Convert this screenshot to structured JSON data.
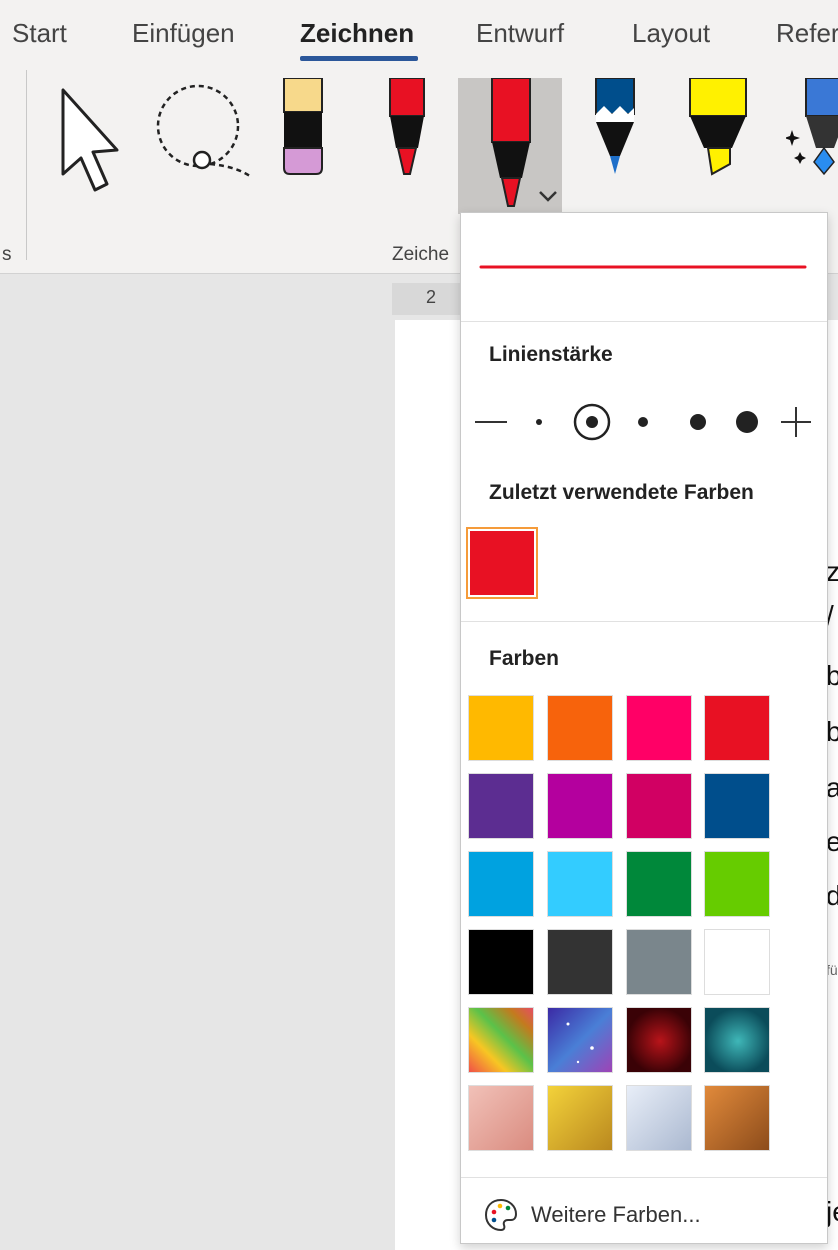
{
  "tabs": [
    {
      "label": "Start",
      "active": false
    },
    {
      "label": "Einfügen",
      "active": false
    },
    {
      "label": "Zeichnen",
      "active": true
    },
    {
      "label": "Entwurf",
      "active": false
    },
    {
      "label": "Layout",
      "active": false
    },
    {
      "label": "Refer",
      "active": false
    }
  ],
  "ribbon": {
    "left_group_label": "s",
    "group_label": "Zeiche",
    "tools": [
      "select-arrow",
      "lasso-select",
      "eraser",
      "red-pen",
      "red-pen-selected",
      "blue-pencil",
      "yellow-highlighter",
      "sparkle-pen"
    ]
  },
  "ruler": {
    "number": "2"
  },
  "document": {
    "visible_chars": [
      "z",
      "/",
      "b",
      "b",
      "a",
      "e",
      "d",
      "fü",
      "je"
    ]
  },
  "panel": {
    "preview_color": "#e81123",
    "thickness_title": "Linienstärke",
    "thickness_selected_index": 0,
    "recent_title": "Zuletzt verwendete Farben",
    "recent_colors": [
      "#e81123"
    ],
    "colors_title": "Farben",
    "colors": [
      [
        "#ffb900",
        "#f7630c",
        "#ff0066",
        "#e81123"
      ],
      [
        "#5c2d91",
        "#b4009e",
        "#d10063",
        "#004e8c"
      ],
      [
        "#00a2e0",
        "#33ccff",
        "#00883a",
        "#66cc00"
      ],
      [
        "#000000",
        "#333333",
        "#7a868c",
        "#ffffff"
      ]
    ],
    "textures": [
      "rainbow-texture",
      "galaxy-texture",
      "ruby-texture",
      "ocean-texture",
      "rose-gold-texture",
      "gold-texture",
      "silver-texture",
      "bronze-texture"
    ],
    "more_colors_label": "Weitere Farben..."
  }
}
